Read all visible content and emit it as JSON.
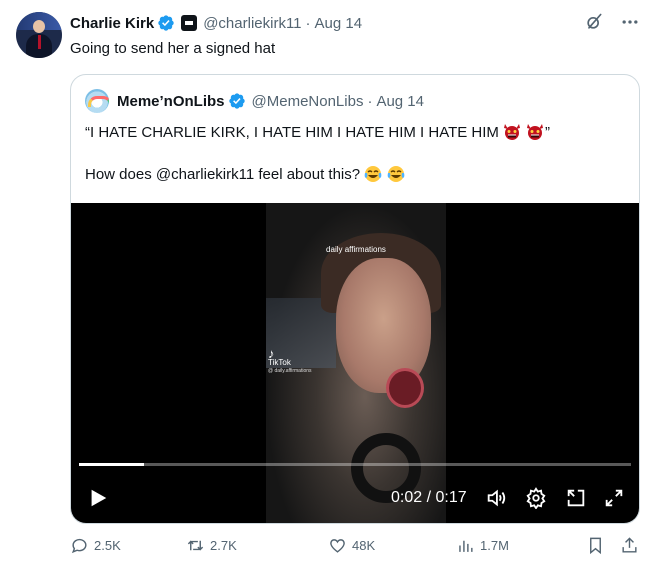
{
  "tweet": {
    "author_name": "Charlie Kirk",
    "author_handle": "@charliekirk11",
    "separator": "·",
    "date": "Aug 14",
    "text": "Going to send her a signed hat"
  },
  "quote": {
    "author_name": "Meme’nOnLibs",
    "author_handle": "@MemeNonLibs",
    "separator": "·",
    "date": "Aug 14",
    "line1_open_quote": "“",
    "line1": "I HATE CHARLIE KIRK, I HATE HIM I HATE HIM I HATE HIM",
    "line1_close_quote": "”",
    "line2": "How does @charliekirk11 feel about this?"
  },
  "video": {
    "caption": "daily affirmations",
    "watermark": "TikTok",
    "watermark_handle": "@ daily.affirmations",
    "current_time": "0:02",
    "time_separator": "/",
    "duration": "0:17",
    "progress_fraction": 0.118
  },
  "actions": {
    "replies": "2.5K",
    "reposts": "2.7K",
    "likes": "48K",
    "views": "1.7M"
  },
  "icons": {
    "verified": "verified-badge-icon",
    "grok": "grok-icon",
    "more": "more-icon",
    "play": "play-icon",
    "volume": "volume-icon",
    "settings": "settings-icon",
    "pip": "picture-in-picture-icon",
    "fullscreen": "fullscreen-icon",
    "reply": "reply-icon",
    "repost": "repost-icon",
    "like": "like-icon",
    "views": "views-icon",
    "bookmark": "bookmark-icon",
    "share": "share-icon"
  },
  "colors": {
    "accent": "#1d9bf0",
    "text": "#0f1419",
    "muted": "#536471",
    "border": "#cfd9de"
  }
}
